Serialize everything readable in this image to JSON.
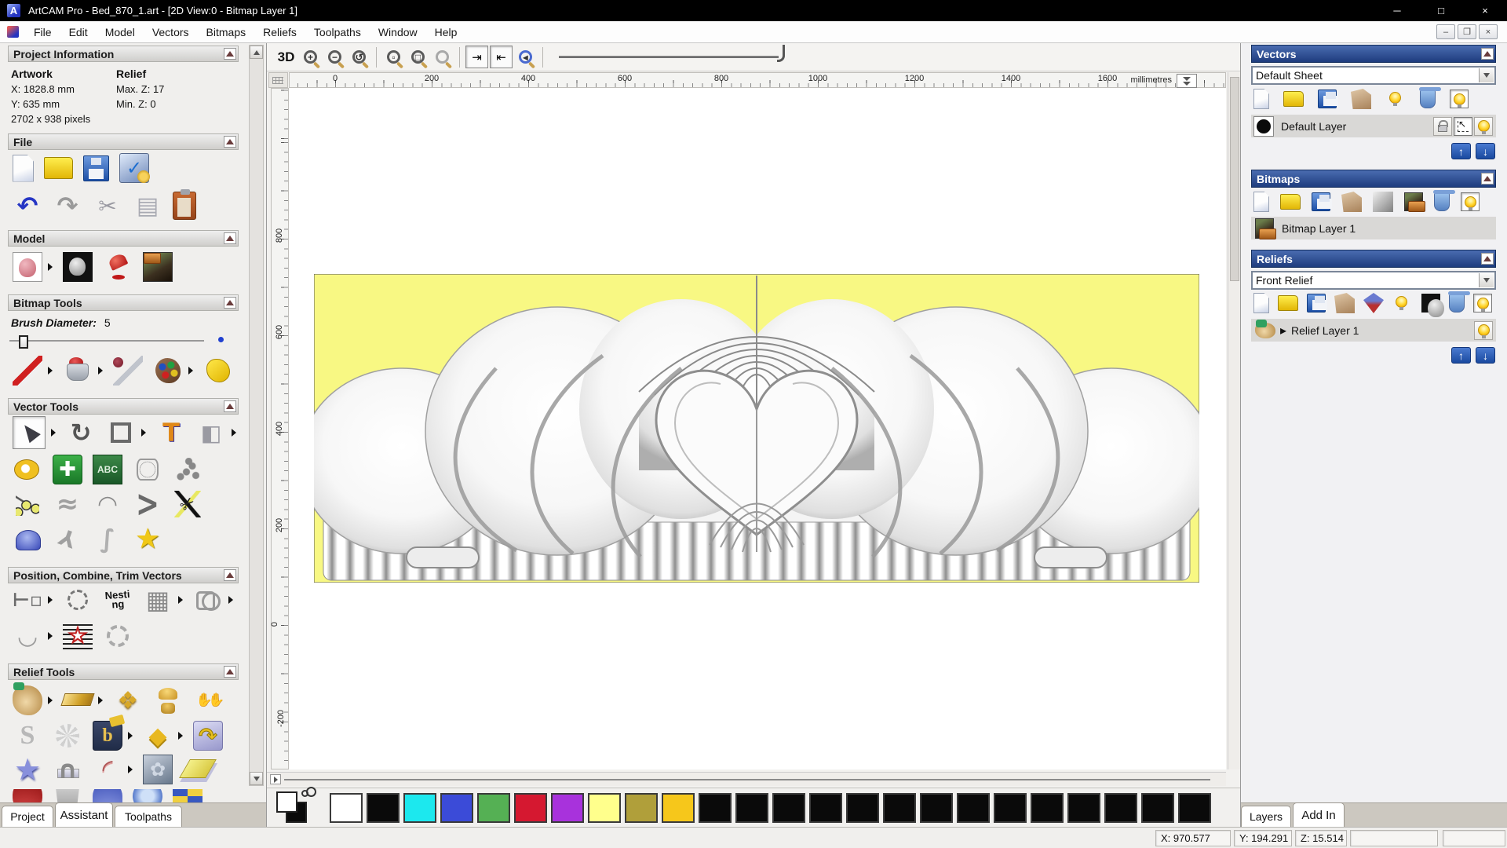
{
  "window": {
    "title": "ArtCAM Pro - Bed_870_1.art - [2D View:0 - Bitmap Layer 1]",
    "minimize": "─",
    "maximize": "□",
    "close": "×"
  },
  "menu": {
    "items": [
      "File",
      "Edit",
      "Model",
      "Vectors",
      "Bitmaps",
      "Reliefs",
      "Toolpaths",
      "Window",
      "Help"
    ]
  },
  "assistant": {
    "project_information": {
      "title": "Project Information",
      "artwork_heading": "Artwork",
      "artwork_x": "X: 1828.8 mm",
      "artwork_y": "Y: 635 mm",
      "artwork_pixels": "2702 x 938 pixels",
      "relief_heading": "Relief",
      "relief_max": "Max. Z: 17",
      "relief_min": "Min. Z: 0"
    },
    "file_section_title": "File",
    "model_section_title": "Model",
    "bitmap_tools_title": "Bitmap Tools",
    "brush_label": "Brush Diameter:",
    "brush_value": "5",
    "vector_tools_title": "Vector Tools",
    "abc_glyph": "ABC",
    "position_section_title": "Position, Combine, Trim Vectors",
    "nesting_glyph": "Nesting",
    "relief_tools_title": "Relief Tools",
    "tabs": [
      {
        "label": "Project"
      },
      {
        "label": "Assistant"
      },
      {
        "label": "Toolpaths"
      }
    ]
  },
  "canvas": {
    "toolbar": {
      "view_3d_label": "3D"
    },
    "ruler": {
      "unit": "millimetres",
      "h_labels": [
        "0",
        "200",
        "400",
        "600",
        "800",
        "1000",
        "1200",
        "1400",
        "1600"
      ],
      "v_labels": [
        "800",
        "600",
        "400",
        "200",
        "0",
        "-200"
      ]
    }
  },
  "layers_panel": {
    "vectors": {
      "title": "Vectors",
      "sheet_selected": "Default Sheet",
      "layer": "Default Layer"
    },
    "bitmaps": {
      "title": "Bitmaps",
      "layer": "Bitmap Layer 1"
    },
    "reliefs": {
      "title": "Reliefs",
      "relief_selected": "Front Relief",
      "layer": "Relief Layer 1"
    },
    "tabs": [
      {
        "label": "Layers"
      },
      {
        "label": "Add In"
      }
    ]
  },
  "palette": {
    "primary": "#ffffff",
    "secondary": "#0a0a0a",
    "swatches": [
      "#ffffff",
      "#0a0a0a",
      "#1ce8ee",
      "#3b4bd8",
      "#55b054",
      "#d51830",
      "#a832dc",
      "#ffff8c",
      "#b09f3a",
      "#f6c71b",
      "#0a0a0a",
      "#0a0a0a",
      "#0a0a0a",
      "#0a0a0a",
      "#0a0a0a",
      "#0a0a0a",
      "#0a0a0a",
      "#0a0a0a",
      "#0a0a0a",
      "#0a0a0a",
      "#0a0a0a",
      "#0a0a0a",
      "#0a0a0a",
      "#0a0a0a"
    ]
  },
  "status_bar": {
    "x": "X: 970.577",
    "y": "Y: 194.291",
    "z": "Z: 15.514"
  }
}
